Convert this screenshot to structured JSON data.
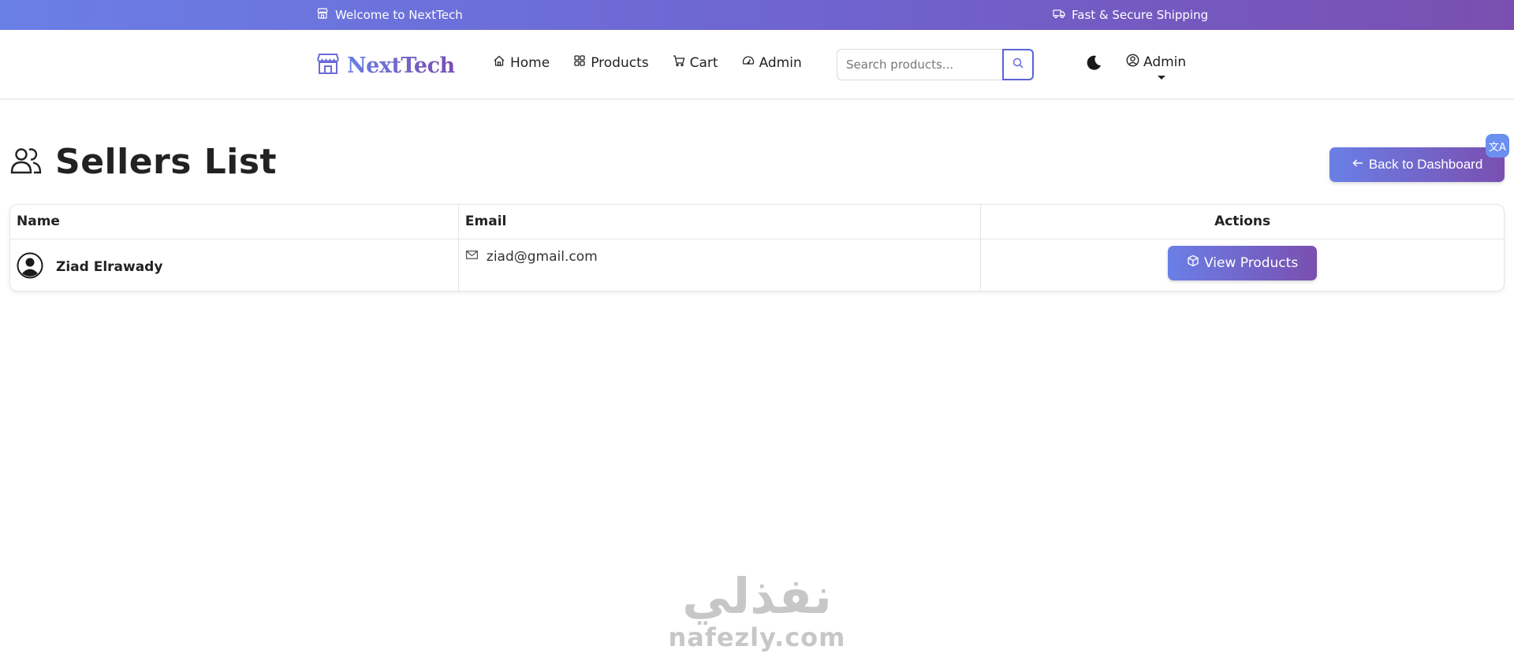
{
  "topbar": {
    "welcome_text": "Welcome to NextTech",
    "shipping_text": "Fast & Secure Shipping"
  },
  "navbar": {
    "brand": "NextTech",
    "links": [
      {
        "label": "Home",
        "icon": "home-icon"
      },
      {
        "label": "Products",
        "icon": "grid-icon"
      },
      {
        "label": "Cart",
        "icon": "cart-icon"
      },
      {
        "label": "Admin",
        "icon": "dashboard-icon"
      }
    ],
    "search_placeholder": "Search products...",
    "user_label": "Admin"
  },
  "page": {
    "title": "Sellers List",
    "back_button": "Back to Dashboard",
    "translate_badge": "文A"
  },
  "table": {
    "headers": [
      "Name",
      "Email",
      "Actions"
    ],
    "rows": [
      {
        "name": "Ziad Elrawady",
        "email": "ziad@gmail.com",
        "action_label": "View Products"
      }
    ]
  },
  "watermark": {
    "arabic": "نفذلي",
    "latin": "nafezly.com"
  },
  "colors": {
    "gradient_start": "#6a7fe6",
    "gradient_end": "#7a4fb0",
    "search_border": "#5a63d4"
  }
}
